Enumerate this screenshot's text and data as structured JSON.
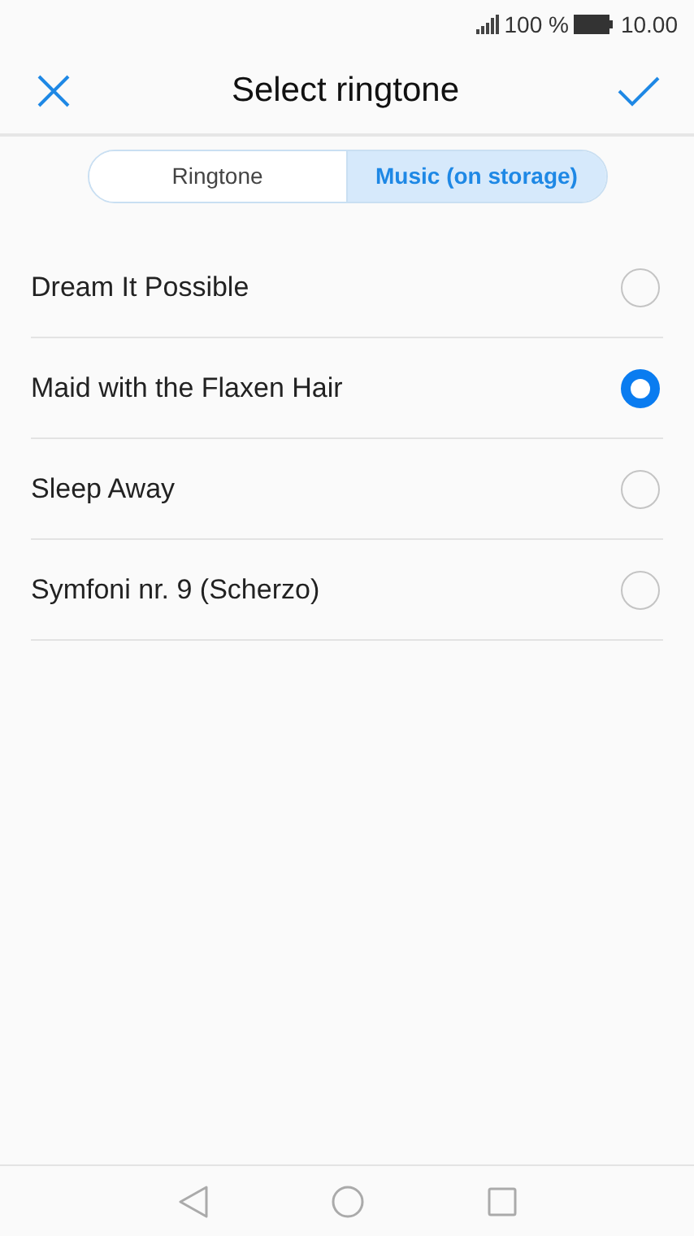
{
  "status_bar": {
    "battery": "100 %",
    "time": "10.00"
  },
  "header": {
    "title": "Select ringtone"
  },
  "tabs": [
    {
      "label": "Ringtone",
      "selected": false
    },
    {
      "label": "Music (on storage)",
      "selected": true
    }
  ],
  "songs": [
    {
      "title": "Dream It Possible",
      "selected": false
    },
    {
      "title": "Maid with the Flaxen Hair",
      "selected": true
    },
    {
      "title": "Sleep Away",
      "selected": false
    },
    {
      "title": "Symfoni nr. 9 (Scherzo)",
      "selected": false
    }
  ]
}
